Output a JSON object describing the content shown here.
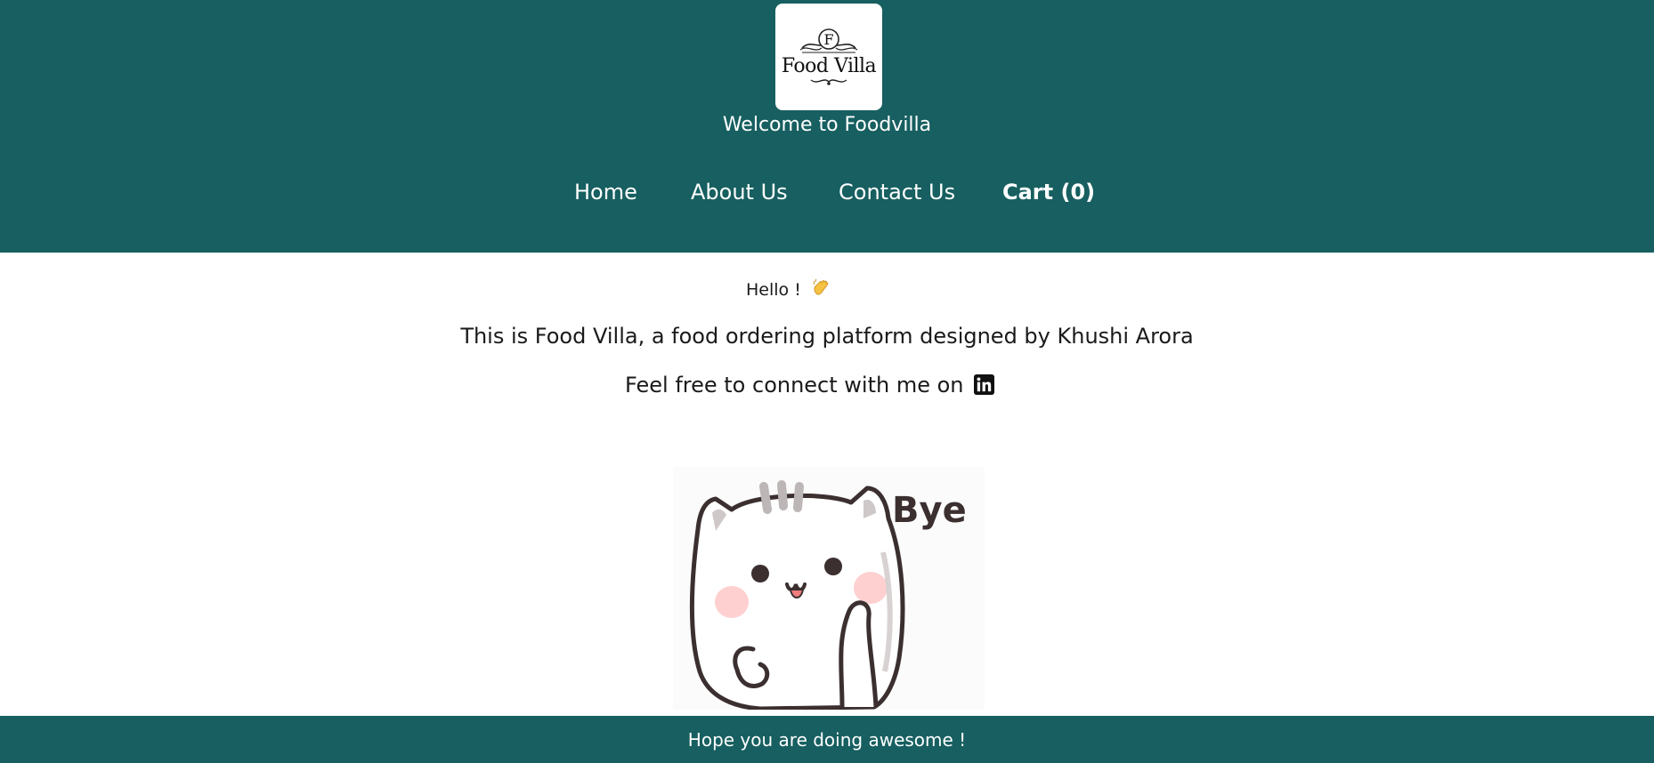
{
  "header": {
    "logo": {
      "letter": "F",
      "name": "Food Villa"
    },
    "welcome": "Welcome to Foodvilla",
    "nav": {
      "home": "Home",
      "about": "About Us",
      "contact": "Contact Us",
      "cart": "Cart (0)"
    }
  },
  "main": {
    "hello": "Hello !",
    "hello_icon": "waving-hand-icon",
    "intro": "This is Food Villa, a food ordering platform designed by Khushi Arora",
    "connect": "Feel free to connect with me on",
    "connect_icon": "linkedin-icon",
    "figure": {
      "caption": "Bye",
      "subject": "waving cat sticker"
    }
  },
  "footer": {
    "message": "Hope you are doing awesome !"
  },
  "colors": {
    "brand": "#175f60",
    "text": "#1a1a1a",
    "white": "#ffffff"
  }
}
